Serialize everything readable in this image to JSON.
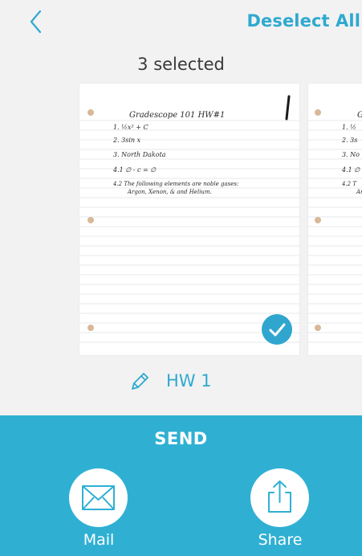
{
  "header": {
    "deselect_label": "Deselect All",
    "selected_count": "3 selected"
  },
  "pages": [
    {
      "lines": [
        "Gradescope 101 HW#1",
        "1. ½x² + C",
        "2. 3sin x",
        "3. North Dakota",
        "4.1 ∅ - c = ∅",
        "4.2 The following elements are noble gases:",
        "Argon, Xenon, & and Helium."
      ],
      "selected": true
    },
    {
      "lines": [
        "G",
        "1. ½",
        "2. 3s",
        "3. No",
        "4.1 ∅",
        "4.2 T",
        "Ar"
      ],
      "selected": false
    }
  ],
  "assignment": {
    "name": "HW 1"
  },
  "send": {
    "title": "SEND",
    "options": [
      {
        "label": "Mail",
        "icon": "mail-icon"
      },
      {
        "label": "Share",
        "icon": "share-icon"
      }
    ]
  },
  "colors": {
    "accent": "#2fa9cf",
    "panel": "#2fb0d3",
    "background": "#f2f2f3"
  }
}
